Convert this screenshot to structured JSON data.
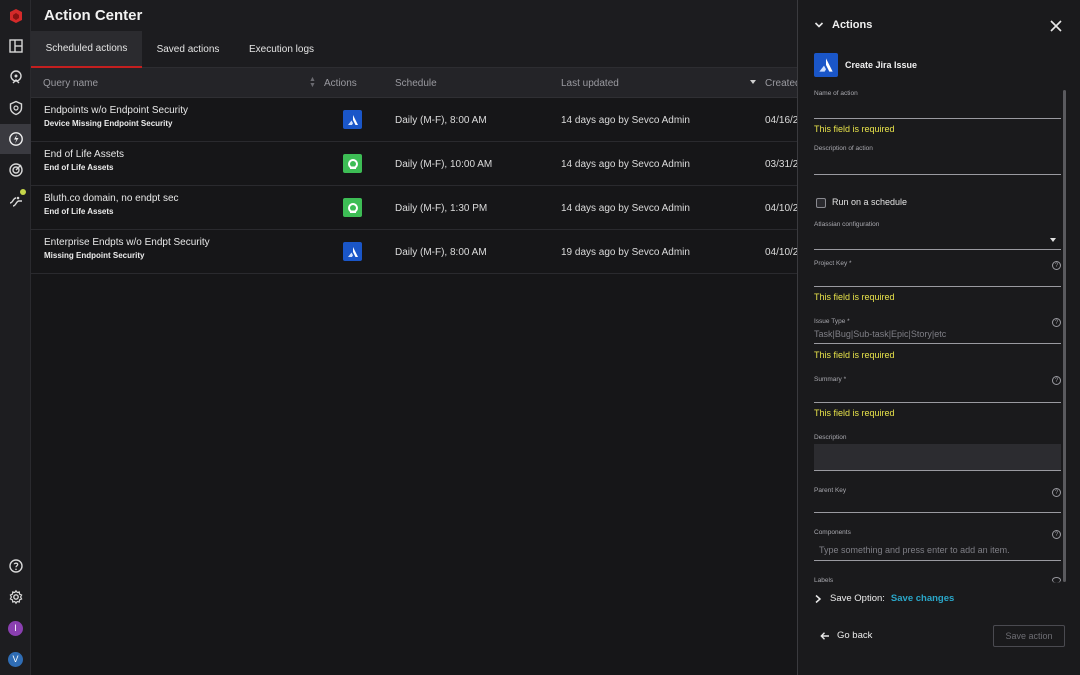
{
  "app": {
    "title": "Action Center"
  },
  "tabs": [
    {
      "label": "Scheduled actions",
      "active": true
    },
    {
      "label": "Saved actions",
      "active": false
    },
    {
      "label": "Execution logs",
      "active": false
    }
  ],
  "table": {
    "columns": [
      "Query name",
      "Actions",
      "Schedule",
      "Last updated",
      "Created"
    ],
    "rows": [
      {
        "name": "Endpoints w/o Endpoint Security",
        "subtitle": "Device Missing Endpoint Security",
        "action_icon": "jira-icon",
        "schedule": "Daily (M-F), 8:00 AM",
        "last_updated": "14 days ago by Sevco Admin",
        "created": "04/16/2"
      },
      {
        "name": "End of Life Assets",
        "subtitle": "End of Life Assets",
        "action_icon": "service-icon",
        "schedule": "Daily (M-F), 10:00 AM",
        "last_updated": "14 days ago by Sevco Admin",
        "created": "03/31/2"
      },
      {
        "name": "Bluth.co domain, no endpt sec",
        "subtitle": "End of Life Assets",
        "action_icon": "service-icon",
        "schedule": "Daily (M-F), 1:30 PM",
        "last_updated": "14 days ago by Sevco Admin",
        "created": "04/10/2"
      },
      {
        "name": "Enterprise Endpts w/o Endpt Security",
        "subtitle": "Missing Endpoint Security",
        "action_icon": "jira-icon",
        "schedule": "Daily (M-F), 8:00 AM",
        "last_updated": "19 days ago by Sevco Admin",
        "created": "04/10/2"
      }
    ]
  },
  "panel": {
    "title": "Actions",
    "action_name": "Create Jira Issue",
    "fields": {
      "name_label": "Name of action",
      "description_of_action_label": "Description of action",
      "run_schedule_label": "Run on a schedule",
      "atlassian_label": "Atlassian configuration",
      "project_key_label": "Project Key *",
      "issue_type_label": "Issue Type *",
      "issue_type_placeholder": "Task|Bug|Sub-task|Epic|Story|etc",
      "summary_label": "Summary *",
      "description_label": "Description",
      "parent_key_label": "Parent Key",
      "components_label": "Components",
      "components_placeholder": "Type something and press enter to add an item.",
      "labels_label": "Labels"
    },
    "required_msg": "This field is required",
    "save_option_label": "Save Option:",
    "save_option_value": "Save changes",
    "go_back": "Go back",
    "save_action": "Save action"
  },
  "user_avatars": [
    "I",
    "V"
  ],
  "colors": {
    "accent": "#c41f1f",
    "required": "#e8e34a",
    "link": "#2aa7c9",
    "jira": "#1a56c8",
    "service": "#3dbd55"
  }
}
